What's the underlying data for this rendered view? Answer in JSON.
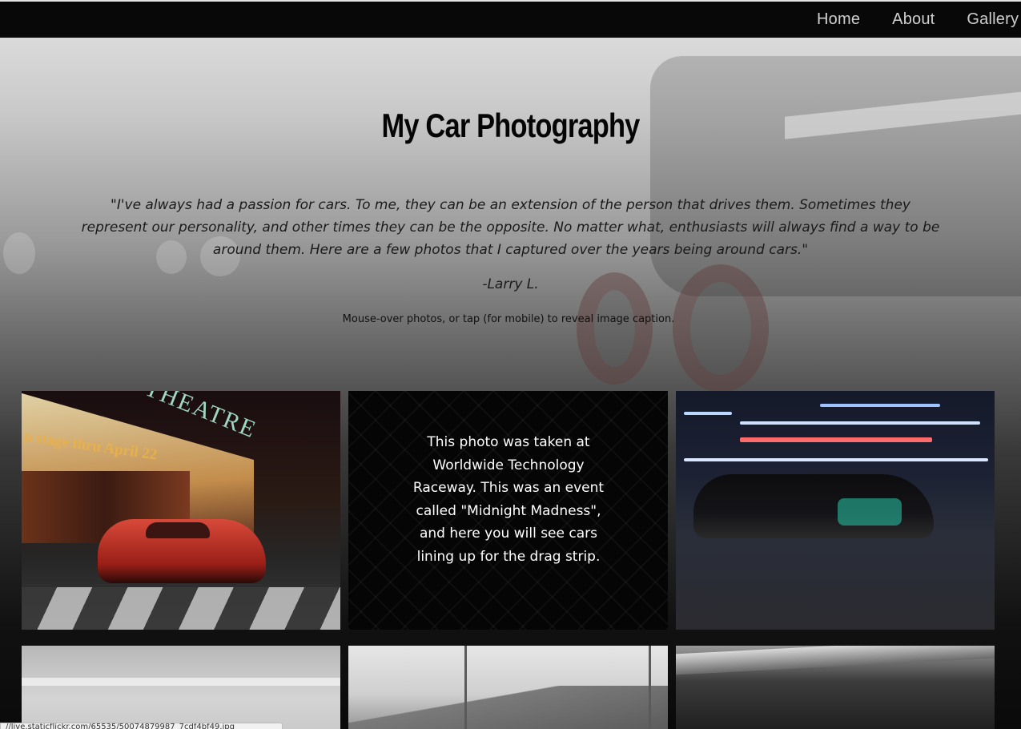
{
  "nav": {
    "items": [
      {
        "label": "Home"
      },
      {
        "label": "About"
      },
      {
        "label": "Gallery"
      }
    ]
  },
  "header": {
    "title": "My Car Photography",
    "quote": "\"I've always had a passion for cars. To me, they can be an extension of the person that drives them. Sometimes they represent our personality, and other times they can be the opposite. No matter what, enthusiasts will always find a way to be around them. Here are a few photos that I captured over the years being around cars.\"",
    "author": "-Larry L.",
    "hint": "Mouse-over photos, or tap (for mobile) to reveal image caption."
  },
  "gallery": {
    "photos": [
      {
        "sign_text": "n stage thru April 22",
        "sign_title": "THEATRE"
      },
      {
        "caption": "This photo was taken at Worldwide Technology Raceway. This was an event called \"Midnight Madness\", and here you will see cars lining up for the drag strip."
      },
      {},
      {},
      {},
      {}
    ]
  },
  "status_bar": {
    "url": "//live.staticflickr.com/65535/50074879987_7cdf4bf49.jpg"
  }
}
